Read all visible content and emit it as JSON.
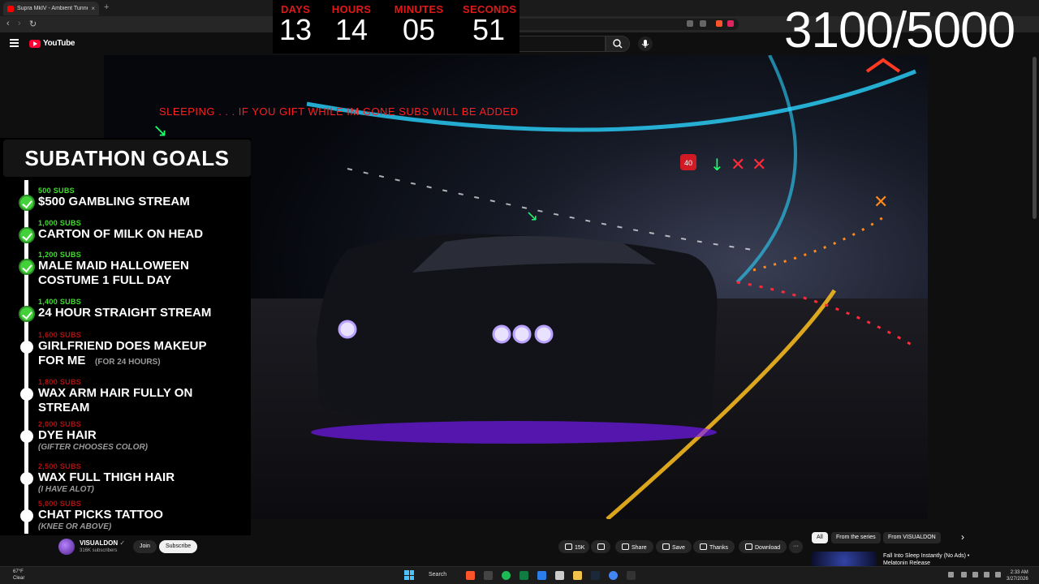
{
  "browser": {
    "tab_title": "Supra MkIV - Ambient Tunnel",
    "tab_close": "×",
    "new_tab": "+",
    "url": "youtube.com/watch?v=OQJSR4mYHx",
    "back": "‹",
    "forward": "›",
    "reload": "↻"
  },
  "youtube": {
    "logo_text": "YouTube",
    "search_placeholder": "Search"
  },
  "overlay": {
    "sleep_message": "SLEEPING . . . IF YOU GIFT WHILE IM GONE SUBS WILL BE ADDED",
    "timer": [
      {
        "label": "DAYS",
        "value": "13"
      },
      {
        "label": "HOURS",
        "value": "14"
      },
      {
        "label": "MINUTES",
        "value": "05"
      },
      {
        "label": "SECONDS",
        "value": "51"
      }
    ],
    "sub_count": "3100/5000",
    "sign_value": "40"
  },
  "goals": {
    "title": "SUBATHON GOALS",
    "items": [
      {
        "subs": "500 SUBS",
        "text": "$500 GAMBLING STREAM",
        "done": true
      },
      {
        "subs": "1,000 SUBS",
        "text": "CARTON OF MILK ON HEAD",
        "done": true
      },
      {
        "subs": "1,200 SUBS",
        "text": "MALE MAID HALLOWEEN",
        "text2": "COSTUME 1 FULL DAY",
        "done": true
      },
      {
        "subs": "1,400 SUBS",
        "text": "24 HOUR STRAIGHT STREAM",
        "done": true
      },
      {
        "subs": "1,600 SUBS",
        "text": "GIRLFRIEND DOES MAKEUP",
        "text2": "FOR ME",
        "note": "(FOR 24 HOURS)",
        "done": false
      },
      {
        "subs": "1,800 SUBS",
        "text": "WAX ARM HAIR FULLY ON",
        "text2": "STREAM",
        "done": false
      },
      {
        "subs": "2,000 SUBS",
        "text": "DYE HAIR",
        "note": "(GIFTER CHOOSES COLOR)",
        "done": false
      },
      {
        "subs": "2,500 SUBS",
        "text": "WAX FULL THIGH HAIR",
        "note": "(I HAVE ALOT)",
        "done": false
      },
      {
        "subs": "5,000 SUBS",
        "text": "CHAT PICKS TATTOO",
        "note": "(KNEE OR ABOVE)",
        "done": false
      }
    ]
  },
  "channel": {
    "name": "VISUALDON",
    "verified": "✓",
    "subscribers": "316K subscribers",
    "join": "Join",
    "subscribe": "Subscribe"
  },
  "actions": {
    "likes": "15K",
    "share": "Share",
    "save": "Save",
    "thanks": "Thanks",
    "download": "Download",
    "more": "···"
  },
  "chips": {
    "all": "All",
    "series": "From the series",
    "channel": "From VISUALDON",
    "next": "›"
  },
  "recommendation": {
    "title": "Fall Into Sleep Instantly (No Ads) • Melatonin Release"
  },
  "taskbar": {
    "temp": "67°F",
    "condition": "Clear",
    "search": "Search",
    "time": "2:33 AM",
    "date": "3/27/2026"
  },
  "colors": {
    "timer_label": "#e01818",
    "goal_done": "#3fe02c",
    "goal_todo": "#b01010",
    "yt_red": "#ff0033"
  }
}
